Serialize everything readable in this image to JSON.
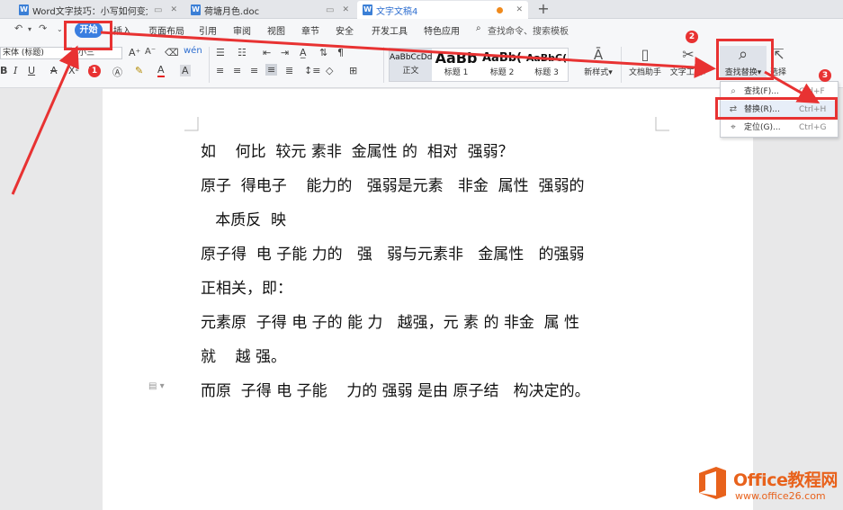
{
  "tabs": [
    {
      "title": "Word文字技巧：小写如何变大写",
      "active": false
    },
    {
      "title": "荷塘月色.doc",
      "active": false
    },
    {
      "title": "文字文稿4",
      "active": true
    }
  ],
  "add_tab": "+",
  "menu": {
    "start": "开始",
    "items": [
      "插入",
      "页面布局",
      "引用",
      "审阅",
      "视图",
      "章节",
      "安全",
      "开发工具",
      "特色应用"
    ],
    "search": "查找命令、搜索模板"
  },
  "ribbon": {
    "font_name": "宋体 (标题)",
    "font_size": "小三",
    "styles": [
      {
        "preview": "AaBbCcDd",
        "label": "正文"
      },
      {
        "preview": "AaBb",
        "label": "标题 1"
      },
      {
        "preview": "AaBb(",
        "label": "标题 2"
      },
      {
        "preview": "AaBbC(",
        "label": "标题 3"
      }
    ],
    "new_style": "新样式",
    "doc_helper": "文档助手",
    "text_tools": "文字工具",
    "find_replace": "查找替换",
    "select": "选择"
  },
  "dropdown": [
    {
      "icon": "search-icon",
      "label": "查找(F)...",
      "shortcut": "Ctrl+F"
    },
    {
      "icon": "replace-icon",
      "label": "替换(R)...",
      "shortcut": "Ctrl+H"
    },
    {
      "icon": "locate-icon",
      "label": "定位(G)...",
      "shortcut": "Ctrl+G"
    }
  ],
  "document": {
    "lines": [
      "如    何比  较元 素非  金属性 的  相对  强弱？",
      "原子  得电子    能力的   强弱是元素   非金  属性  强弱的",
      "   本质反  映",
      "原子得  电 子能 力的   强   弱与元素非   金属性   的强弱",
      "正相关，即：",
      "元素原  子得 电 子的 能 力   越强，元 素 的 非金  属 性",
      "就    越 强。",
      "而原  子得 电 子能    力的 强弱 是由 原子结   构决定的。"
    ]
  },
  "annotations": {
    "step1": "1",
    "step2": "2",
    "step3": "3"
  },
  "watermark": {
    "title": "Office教程网",
    "url": "www.office26.com"
  },
  "colors": {
    "accent": "#3a7ee0",
    "annotation": "#e83232",
    "watermark": "#e8621c"
  }
}
